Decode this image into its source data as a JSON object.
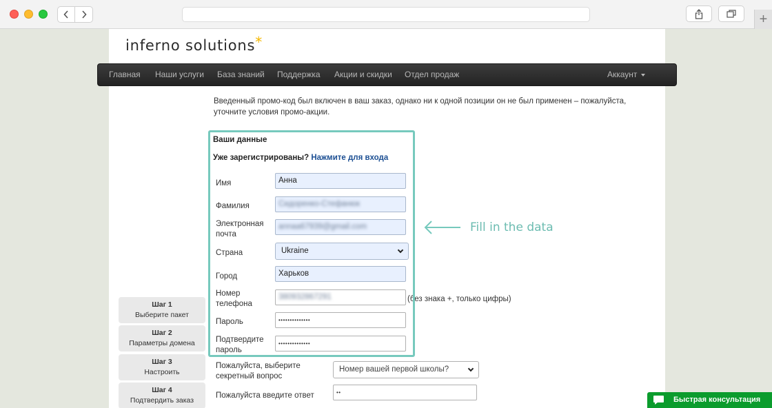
{
  "browser": {
    "traffic_lights": [
      "close",
      "minimize",
      "zoom"
    ],
    "url": ""
  },
  "site": {
    "logo_text": "inferno solutions",
    "logo_star": "*",
    "nav": {
      "items": [
        "Главная",
        "Наши услуги",
        "База знаний",
        "Поддержка",
        "Акции и скидки",
        "Отдел продаж"
      ],
      "account": "Аккаунт"
    },
    "notice": "Введенный промо-код был включен в ваш заказ, однако ни к одной позиции он не был применен – пожалуйста, уточните условия промо-акции."
  },
  "form": {
    "section_title": "Ваши данные",
    "already_text": "Уже зарегистрированы?",
    "login_link": "Нажмите для входа",
    "fields": {
      "first_name": {
        "label": "Имя",
        "value": "Анна"
      },
      "last_name": {
        "label": "Фамилия",
        "value": "Сидоренко-Стефанюк"
      },
      "email": {
        "label_line1": "Электронная",
        "label_line2": "почта",
        "value": "annaa67939@gmail.com"
      },
      "country": {
        "label": "Страна",
        "value": "Ukraine"
      },
      "city": {
        "label": "Город",
        "value": "Харьков"
      },
      "phone": {
        "label_line1": "Номер",
        "label_line2": "телефона",
        "value": "380932867291",
        "hint": "(без знака +, только цифры)"
      },
      "password": {
        "label": "Пароль",
        "value": "••••••••••••••"
      },
      "password_confirm": {
        "label_line1": "Подтвердите",
        "label_line2": "пароль",
        "value": "••••••••••••••"
      },
      "secret_question": {
        "label_line1": "Пожалуйста, выберите",
        "label_line2": "секретный вопрос",
        "value": "Номер вашей первой школы?"
      },
      "secret_answer": {
        "label": "Пожалуйста введите ответ",
        "value": "••"
      }
    }
  },
  "steps": [
    {
      "title": "Шаг 1",
      "subtitle": "Выберите пакет"
    },
    {
      "title": "Шаг 2",
      "subtitle": "Параметры домена"
    },
    {
      "title": "Шаг 3",
      "subtitle": "Настроить"
    },
    {
      "title": "Шаг 4",
      "subtitle": "Подтвердить заказ"
    }
  ],
  "annotation": {
    "text": "Fill in the data",
    "color": "#6cbcb1"
  },
  "chat_widget": {
    "label": "Быстрая консультация",
    "color": "#0b9c2d"
  }
}
